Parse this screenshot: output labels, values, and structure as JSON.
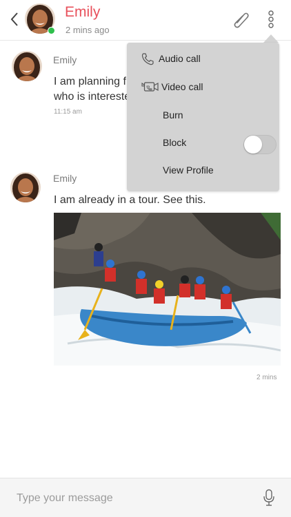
{
  "header": {
    "contact_name": "Emily",
    "status": "2 mins ago"
  },
  "messages": [
    {
      "sender": "Emily",
      "text_line1": "I am planning f",
      "text_line2": "who is intereste",
      "time": "11:15 am"
    },
    {
      "sender": "Emily",
      "text": "I am already in a tour. See this.",
      "time": "2 mins"
    }
  ],
  "menu": {
    "items": [
      {
        "label": "Audio call",
        "icon": "phone-icon"
      },
      {
        "label": "Video call",
        "icon": "video-camera-icon"
      },
      {
        "label": "Burn"
      },
      {
        "label": "Block",
        "toggle_on": false
      },
      {
        "label": "View Profile"
      }
    ]
  },
  "composer": {
    "placeholder": "Type your message"
  },
  "colors": {
    "accent": "#e8505b",
    "online": "#2fbf4c",
    "menu_bg": "#d3d3d3"
  }
}
